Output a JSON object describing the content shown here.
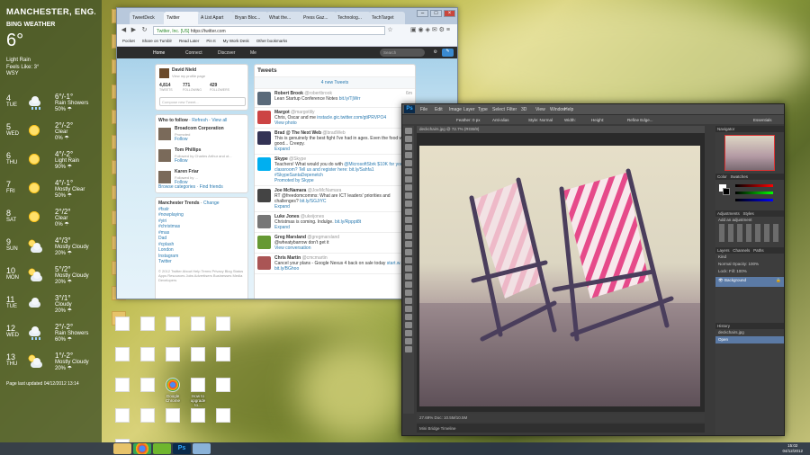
{
  "weather": {
    "city": "MANCHESTER, ENG...",
    "brand": "BING WEATHER",
    "temp": "6°",
    "condition": "Light Rain",
    "feels": "Feels Like: 3°",
    "wind": "WSY",
    "updated": "Page last updated 04/12/2012 13:14",
    "forecast": [
      {
        "day": "4",
        "dow": "TUE",
        "hl": "6°/-1°",
        "cond": "Rain Showers",
        "pct": "50% ☂",
        "icon": "cloud-rain"
      },
      {
        "day": "5",
        "dow": "WED",
        "hl": "2°/-2°",
        "cond": "Clear",
        "pct": "0% ☂",
        "icon": "sun"
      },
      {
        "day": "6",
        "dow": "THU",
        "hl": "4°/-2°",
        "cond": "Light Rain",
        "pct": "90% ☂",
        "icon": "sun"
      },
      {
        "day": "7",
        "dow": "FRI",
        "hl": "4°/-1°",
        "cond": "Mostly Clear",
        "pct": "50% ☂",
        "icon": "sun"
      },
      {
        "day": "8",
        "dow": "SAT",
        "hl": "2°/2°",
        "cond": "Clear",
        "pct": "0% ☂",
        "icon": "sun"
      },
      {
        "day": "9",
        "dow": "SUN",
        "hl": "4°/3°",
        "cond": "Mostly Cloudy",
        "pct": "20% ☂",
        "icon": "cloud-sun"
      },
      {
        "day": "10",
        "dow": "MON",
        "hl": "5°/2°",
        "cond": "Mostly Cloudy",
        "pct": "20% ☂",
        "icon": "cloud-sun"
      },
      {
        "day": "11",
        "dow": "TUE",
        "hl": "3°/1°",
        "cond": "Cloudy",
        "pct": "20% ☂",
        "icon": "cloud"
      },
      {
        "day": "12",
        "dow": "WED",
        "hl": "2°/-2°",
        "cond": "Rain Showers",
        "pct": "60% ☂",
        "icon": "cloud-rain"
      },
      {
        "day": "13",
        "dow": "THU",
        "hl": "1°/-2°",
        "cond": "Mostly Cloudy",
        "pct": "20% ☂",
        "icon": "cloud-sun"
      }
    ]
  },
  "browser": {
    "tabs": [
      "TweetDeck",
      "Twitter",
      "A List Apart",
      "Bryan Bloc...",
      "What the...",
      "Press Gaz...",
      "Technolog...",
      "TechTarget"
    ],
    "url": "https://twitter.com",
    "cert": "Twitter, Inc. [US]",
    "bookmarks": [
      "Pocket",
      "Share on Tumblr",
      "Read Later",
      "Pin It",
      "My Work Desk",
      "Other bookmarks"
    ],
    "nav": [
      "Home",
      "Connect",
      "Discover",
      "Me"
    ],
    "search_placeholder": "Search",
    "profile": {
      "name": "David Nield",
      "link": "View my profile page",
      "tweets": "4,814",
      "following": "771",
      "followers": "429",
      "tweets_lbl": "TWEETS",
      "following_lbl": "FOLLOWING",
      "followers_lbl": "FOLLOWERS",
      "compose": "Compose new Tweet..."
    },
    "who": {
      "title": "Who to follow",
      "refresh": "Refresh",
      "viewall": "View all",
      "items": [
        {
          "name": "Broadcom Corporation",
          "sub": "Promoted",
          "action": "Follow"
        },
        {
          "name": "Tom Phillips",
          "sub": "Followed by Charles Arthur and ot...",
          "action": "Follow"
        },
        {
          "name": "Karen Friar",
          "sub": "Followed by ...",
          "action": "Follow"
        }
      ],
      "browse": "Browse categories",
      "find": "Find friends"
    },
    "trends": {
      "title": "Manchester Trends",
      "change": "Change",
      "items": [
        "#fsslr",
        "#nowplaying",
        "#yiri",
        "#christmas",
        "#mas",
        "Dad",
        "#cplash",
        "London",
        "Instagram",
        "Twitter"
      ]
    },
    "footer": "© 2012 Twitter  About  Help  Terms  Privacy  Blog  Status  Apps  Resources  Jobs  Advertisers  Businesses  Media  Developers",
    "tweets_title": "Tweets",
    "new_tweets": "4 new Tweets",
    "timeline": [
      {
        "name": "Robert Brook",
        "handle": "@robertbrook",
        "text": "Lean Startup Conference Notes",
        "link": "bit.ly/TjWrr",
        "extra": "",
        "time": "6m"
      },
      {
        "name": "Margot",
        "handle": "@margotlily",
        "text": "Chris, Oscar and me",
        "link": "instacle.gic.twitter.com/gtiPRVPO4",
        "extra": "View photo",
        "time": ""
      },
      {
        "name": "Brad @ The Next Web",
        "handle": "@bradWeb",
        "text": "This is genuinely the best fight I've had in ages. Even the food was good... Creepy.",
        "link": "",
        "extra": "Expand",
        "time": ""
      },
      {
        "name": "Skype",
        "handle": "@Skype",
        "text": "Teachers! What would you do with",
        "link": "@MicrosoftSbrk $10K for your classroom? Tell us and register here: bit.ly/Sahfa1 #SkypeSantaDepenetch",
        "extra": "Promoted by Skype",
        "time": ""
      },
      {
        "name": "Joe McNamara",
        "handle": "@JoeMcNamara",
        "text": "RT @freedomcomms: What are ICT leaders' priorities and challenges?",
        "link": "bit.ly/SGJiYC",
        "extra": "Expand",
        "time": ""
      },
      {
        "name": "Luke Jones",
        "handle": "@ukeijones",
        "text": "Christmas is coming. Indulge.",
        "link": "bit.ly/Rpppt8t",
        "extra": "Expand",
        "time": ""
      },
      {
        "name": "Greg Marsland",
        "handle": "@gregmarsland",
        "text": "@wheatybarrow don't get it",
        "link": "",
        "extra": "View conversation",
        "time": ""
      },
      {
        "name": "Chris Martin",
        "handle": "@cmcmartin",
        "text": "Cancel your plans - Google Nexus 4 back on sale today",
        "link": "start.w... bit.ly/BGhoo",
        "extra": "",
        "time": ""
      }
    ]
  },
  "photoshop": {
    "menus": [
      "File",
      "Edit",
      "Image",
      "Layer",
      "Type",
      "Select",
      "Filter",
      "3D",
      "View",
      "Window",
      "Help"
    ],
    "options": [
      "Feather: 0 px",
      "Anti-alias",
      "Style: Normal",
      "Width:",
      "Height:",
      "Refine Edge...",
      "Essentials"
    ],
    "doc_tab": "deckchairs.jpg @ 72.7% (RGB/8)",
    "status": "27.69%    Doc: 10.5M/10.5M",
    "minibridge": "Mini Bridge   Timeline",
    "panels": {
      "navigator": "Navigator",
      "color": "Color",
      "swatches": "Swatches",
      "adjustments": "Adjustments",
      "styles": "Styles",
      "add_adj": "Add an adjustment",
      "layers": "Layers",
      "channels": "Channels",
      "paths": "Paths",
      "kind": "Kind",
      "normal": "Normal",
      "opacity": "Opacity: 100%",
      "lock": "Lock:",
      "fill": "Fill: 100%",
      "background": "Background",
      "history": "History",
      "history_file": "deckchairs.jpg",
      "history_open": "Open"
    }
  },
  "desktop": {
    "icons": [
      "",
      "",
      "",
      "",
      "",
      "",
      "",
      "",
      "",
      "",
      "",
      "",
      "Google Chrome",
      "How to upgrade to...",
      "",
      "",
      "",
      "",
      "",
      "",
      ""
    ]
  },
  "taskbar": {
    "time": "15:02",
    "date": "04/12/2012"
  }
}
